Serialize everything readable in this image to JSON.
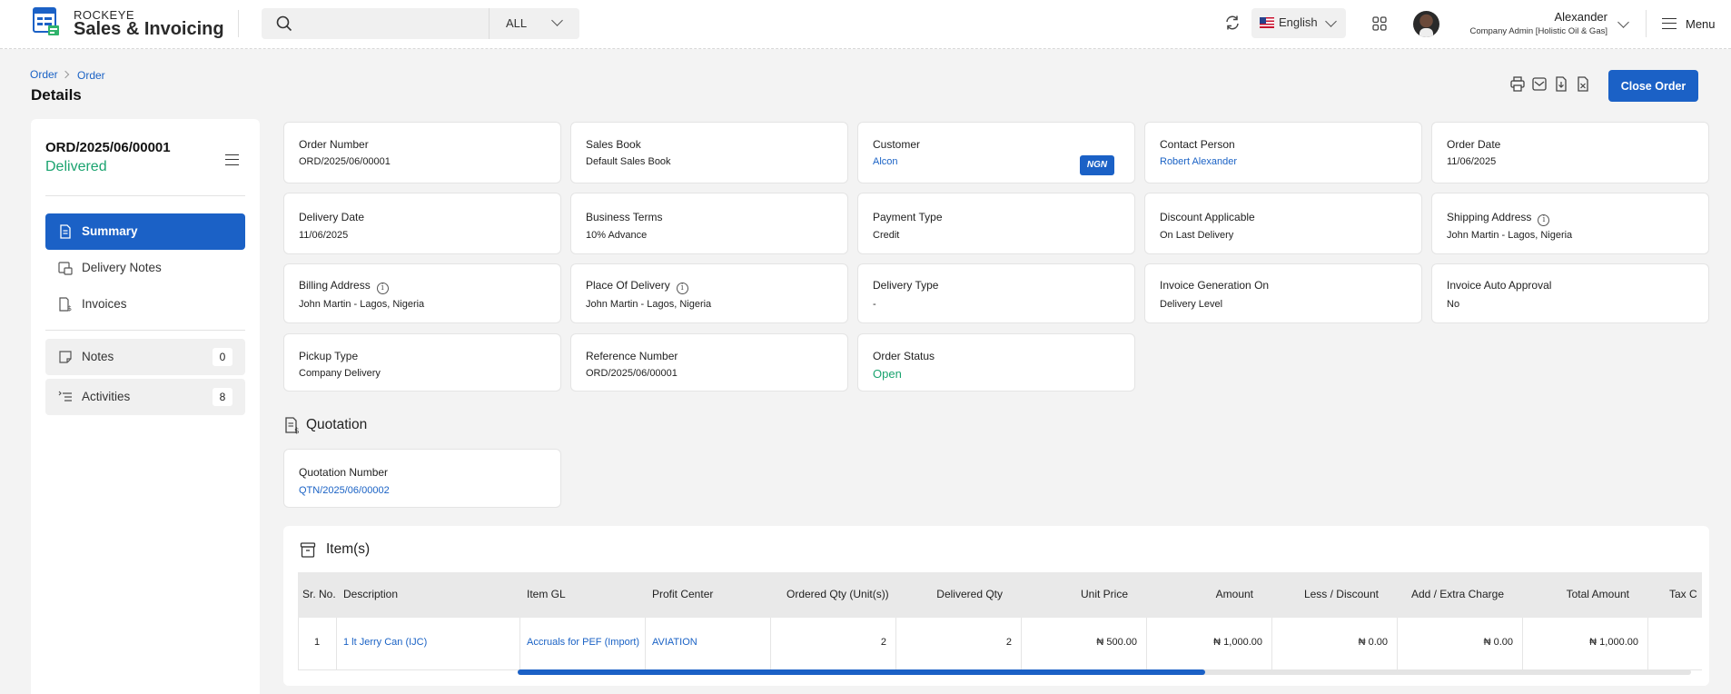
{
  "app": {
    "brand_top": "ROCKEYE",
    "brand_main": "Sales & Invoicing"
  },
  "search": {
    "value": "",
    "placeholder": "",
    "scope": "ALL"
  },
  "language": "English",
  "user": {
    "name": "Alexander",
    "role": "Company Admin [Holistic Oil & Gas]"
  },
  "menu_label": "Menu",
  "breadcrumb": [
    "Order",
    "Order"
  ],
  "page_title": "Details",
  "actions": {
    "close_order": "Close Order"
  },
  "colors": {
    "primary": "#1b61c6",
    "success": "#1aa36f",
    "link": "#1a62c5"
  },
  "sidebar": {
    "order_number": "ORD/2025/06/00001",
    "order_state": "Delivered",
    "nav": [
      {
        "label": "Summary",
        "icon": "document-icon",
        "active": true
      },
      {
        "label": "Delivery Notes",
        "icon": "delivery-note-icon",
        "active": false
      },
      {
        "label": "Invoices",
        "icon": "invoice-icon",
        "active": false
      }
    ],
    "extras": [
      {
        "label": "Notes",
        "icon": "note-icon",
        "count": "0"
      },
      {
        "label": "Activities",
        "icon": "activity-icon",
        "count": "8"
      }
    ]
  },
  "fields": [
    {
      "label": "Order Number",
      "value": "ORD/2025/06/00001"
    },
    {
      "label": "Sales Book",
      "value": "Default Sales Book"
    },
    {
      "label": "Customer",
      "value": "Alcon",
      "badge": "NGN"
    },
    {
      "label": "Contact Person",
      "value": "Robert Alexander"
    },
    {
      "label": "Order Date",
      "value": "11/06/2025"
    },
    {
      "label": "Delivery Date",
      "value": "11/06/2025"
    },
    {
      "label": "Business Terms",
      "value": "10% Advance"
    },
    {
      "label": "Payment Type",
      "value": "Credit"
    },
    {
      "label": "Discount Applicable",
      "value": "On Last Delivery"
    },
    {
      "label": "Shipping Address",
      "value": "John Martin - Lagos, Nigeria"
    },
    {
      "label": "Billing Address",
      "value": "John Martin - Lagos, Nigeria"
    },
    {
      "label": "Place Of Delivery",
      "value": "John Martin - Lagos, Nigeria"
    },
    {
      "label": "Delivery Type",
      "value": "-"
    },
    {
      "label": "Invoice Generation On",
      "value": "Delivery Level"
    },
    {
      "label": "Invoice Auto Approval",
      "value": "No"
    },
    {
      "label": "Pickup Type",
      "value": "Company Delivery"
    },
    {
      "label": "Reference Number",
      "value": "ORD/2025/06/00001"
    },
    {
      "label": "Order Status",
      "value": "Open"
    }
  ],
  "quotation": {
    "title": "Quotation",
    "label": "Quotation Number",
    "value": "QTN/2025/06/00002"
  },
  "items": {
    "title": "Item(s)",
    "columns": [
      "Sr. No.",
      "Description",
      "Item GL",
      "Profit Center",
      "Ordered Qty (Unit(s))",
      "Delivered Qty",
      "Unit Price",
      "Amount",
      "Less / Discount",
      "Add / Extra Charge",
      "Total Amount",
      "Tax C"
    ],
    "rows": [
      [
        "1",
        "1 lt Jerry Can (IJC)",
        "Accruals for PEF (Import)",
        "AVIATION",
        "2",
        "2",
        "₦ 500.00",
        "₦ 1,000.00",
        "₦ 0.00",
        "₦ 0.00",
        "₦ 1,000.00",
        ""
      ]
    ]
  }
}
